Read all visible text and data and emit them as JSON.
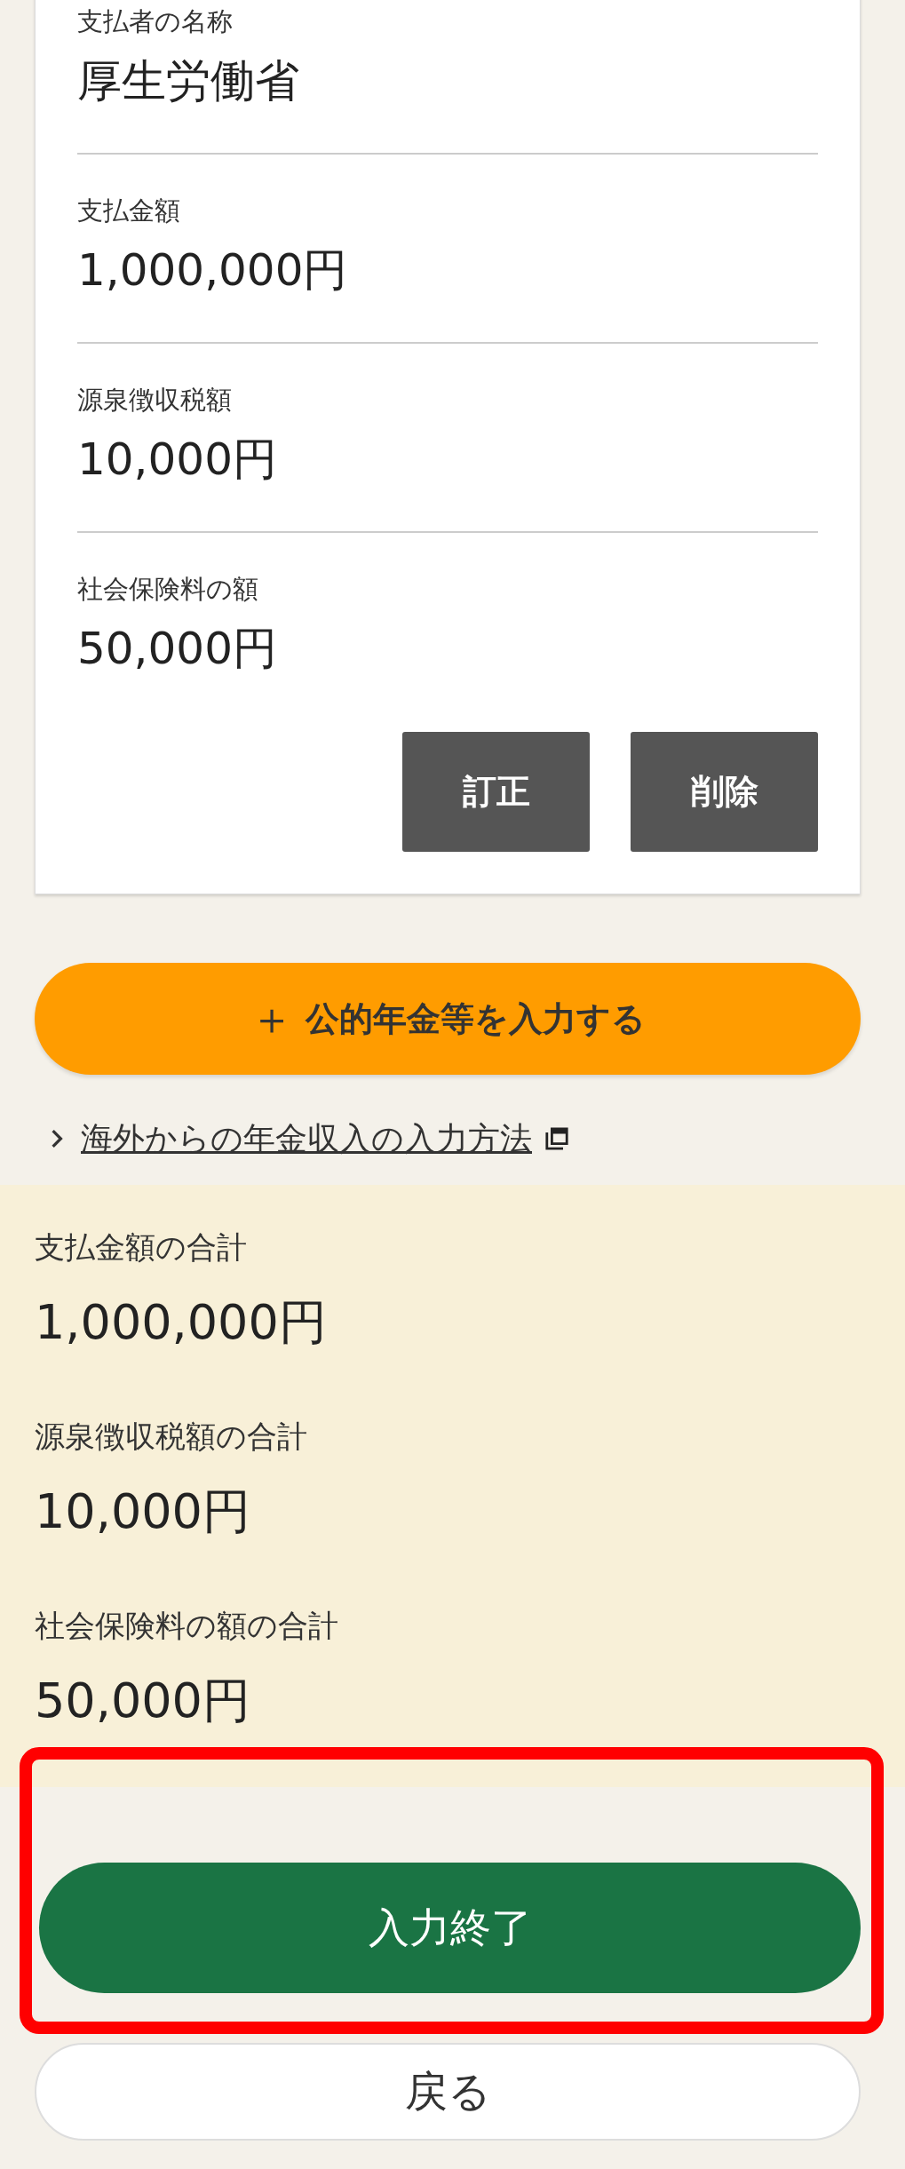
{
  "payer_card": {
    "fields": [
      {
        "label": "支払者の名称",
        "value": "厚生労働省"
      },
      {
        "label": "支払金額",
        "value": "1,000,000円"
      },
      {
        "label": "源泉徴収税額",
        "value": "10,000円"
      },
      {
        "label": "社会保険料の額",
        "value": "50,000円"
      }
    ],
    "buttons": [
      "訂正",
      "削除"
    ]
  },
  "add_button": {
    "icon": "＋",
    "label": "公的年金等を入力する"
  },
  "help_link": {
    "label": "海外からの年金収入の入力方法",
    "opens_new_window": true
  },
  "totals": [
    {
      "label": "支払金額の合計",
      "value": "1,000,000円"
    },
    {
      "label": "源泉徴収税額の合計",
      "value": "10,000円"
    },
    {
      "label": "社会保険料の額の合計",
      "value": "50,000円"
    }
  ],
  "finish_button": {
    "label": "入力終了",
    "highlighted": true
  },
  "back_button": {
    "label": "戻る"
  }
}
